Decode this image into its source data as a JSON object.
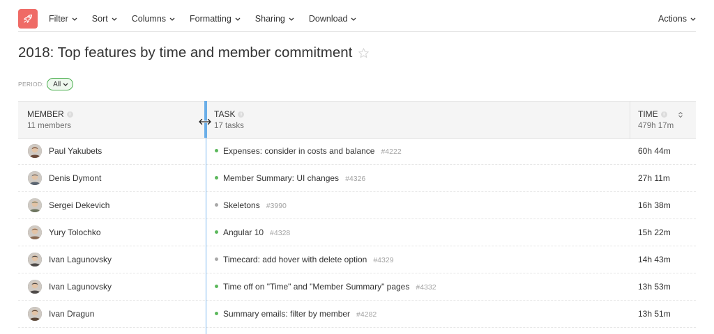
{
  "toolbar": {
    "logo_icon": "rocket-icon",
    "menus": [
      "Filter",
      "Sort",
      "Columns",
      "Formatting",
      "Sharing",
      "Download"
    ],
    "actions_label": "Actions"
  },
  "page": {
    "title": "2018: Top features by time and member commitment"
  },
  "period": {
    "label": "PERIOD:",
    "value": "All"
  },
  "table": {
    "columns": {
      "member": {
        "title": "MEMBER",
        "summary": "11 members"
      },
      "task": {
        "title": "TASK",
        "summary": "17 tasks"
      },
      "time": {
        "title": "TIME",
        "summary": "479h 17m"
      }
    },
    "rows": [
      {
        "member": "Paul Yakubets",
        "task": "Expenses: consider in costs and balance",
        "task_id": "#4222",
        "time": "60h 44m",
        "status_color": "#5cb85c",
        "avatar_color": "#6b4a3a"
      },
      {
        "member": "Denis Dymont",
        "task": "Member Summary: UI changes",
        "task_id": "#4326",
        "time": "27h 11m",
        "status_color": "#5cb85c",
        "avatar_color": "#5a6470"
      },
      {
        "member": "Sergei Dekevich",
        "task": "Skeletons",
        "task_id": "#3990",
        "time": "16h 38m",
        "status_color": "#a8a8a8",
        "avatar_color": "#6e7660"
      },
      {
        "member": "Yury Tolochko",
        "task": "Angular 10",
        "task_id": "#4328",
        "time": "15h 22m",
        "status_color": "#5cb85c",
        "avatar_color": "#8a6a52"
      },
      {
        "member": "Ivan Lagunovsky",
        "task": "Timecard: add hover with delete option",
        "task_id": "#4329",
        "time": "14h 43m",
        "status_color": "#a8a8a8",
        "avatar_color": "#4e4a48"
      },
      {
        "member": "Ivan Lagunovsky",
        "task": "Time off on \"Time\" and \"Member Summary\" pages",
        "task_id": "#4332",
        "time": "13h 53m",
        "status_color": "#5cb85c",
        "avatar_color": "#4e4a48"
      },
      {
        "member": "Ivan Dragun",
        "task": "Summary emails: filter by member",
        "task_id": "#4282",
        "time": "13h 51m",
        "status_color": "#5cb85c",
        "avatar_color": "#5b4636"
      }
    ]
  }
}
